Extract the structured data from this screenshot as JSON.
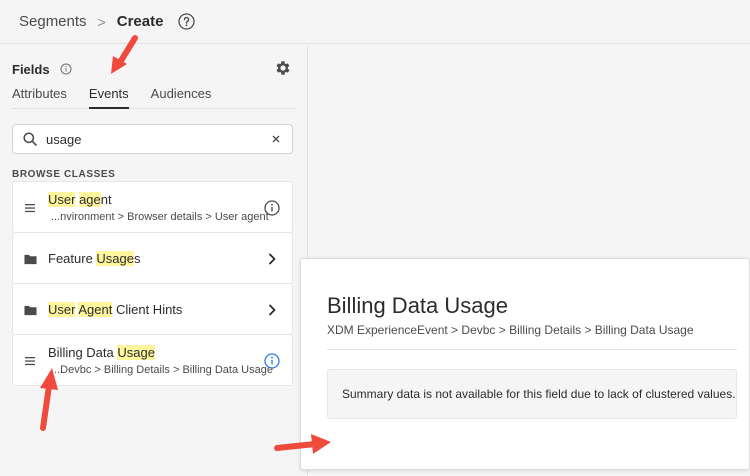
{
  "header": {
    "breadcrumb_parent": "Segments",
    "breadcrumb_separator": ">",
    "breadcrumb_current": "Create",
    "help_icon": "help-circle-icon"
  },
  "fields_panel": {
    "title": "Fields",
    "info_icon": "info-icon",
    "settings_icon": "gear-icon",
    "tabs": [
      {
        "label": "Attributes",
        "active": false
      },
      {
        "label": "Events",
        "active": true
      },
      {
        "label": "Audiences",
        "active": false
      }
    ],
    "search": {
      "value": "usage",
      "placeholder": "Search"
    },
    "browse_label": "BROWSE CLASSES",
    "items": [
      {
        "kind": "field",
        "title_parts": [
          {
            "text": "User",
            "hl": true
          },
          {
            "text": " ",
            "hl": false
          },
          {
            "text": "age",
            "hl": true
          },
          {
            "text": "nt",
            "hl": false
          }
        ],
        "path": "...nvironment > Browser details > User agent",
        "right_icon": "info-icon"
      },
      {
        "kind": "folder",
        "title_parts": [
          {
            "text": "Feature ",
            "hl": false
          },
          {
            "text": "Usage",
            "hl": true
          },
          {
            "text": "s",
            "hl": false
          }
        ],
        "path": "",
        "right_icon": "chevron-right-icon"
      },
      {
        "kind": "folder",
        "title_parts": [
          {
            "text": "User",
            "hl": true
          },
          {
            "text": " ",
            "hl": false
          },
          {
            "text": "Agent",
            "hl": true
          },
          {
            "text": " Client Hints",
            "hl": false
          }
        ],
        "path": "",
        "right_icon": "chevron-right-icon"
      },
      {
        "kind": "field",
        "title_parts": [
          {
            "text": "Billing Data ",
            "hl": false
          },
          {
            "text": "Usage",
            "hl": true
          }
        ],
        "path": "...Devbc > Billing Details > Billing Data Usage",
        "right_icon": "info-icon"
      }
    ]
  },
  "popover": {
    "title": "Billing Data Usage",
    "path": "XDM ExperienceEvent > Devbc > Billing Details > Billing Data Usage",
    "summary": "Summary data is not available for this field due to lack of clustered values."
  },
  "colors": {
    "highlight": "#fff59d",
    "info_blue": "#2680eb",
    "annotation_red": "#f04a3c"
  }
}
